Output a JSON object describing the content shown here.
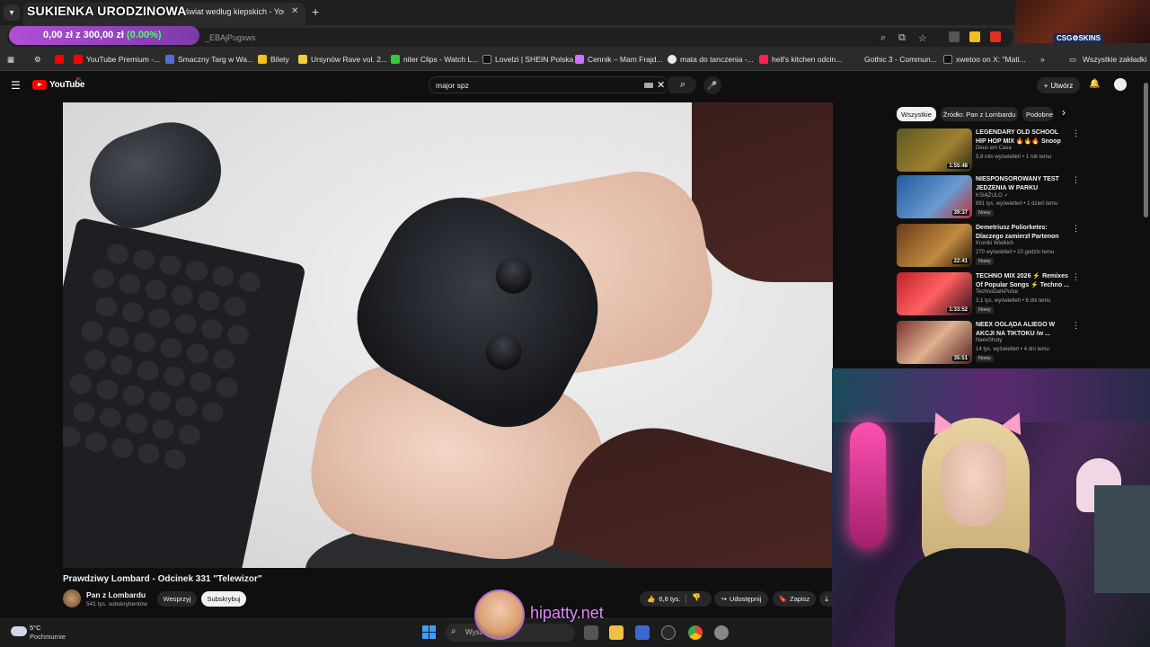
{
  "browser": {
    "overlay_title": "SUKIENKA URODZINOWA",
    "tab_title": "świat według kiepskich - YouTube",
    "tab_close": "✕",
    "new_tab": "+",
    "url_fragment": "_EBAjPugxws",
    "donation": {
      "amount": "0,00 zł",
      "sep": "z",
      "goal": "300,00 zł",
      "percent": "(0.00%)"
    },
    "bookmarks": [
      {
        "label": "YouTube Premium -...",
        "color": "#ff0000"
      },
      {
        "label": "Smaczny Targ w Wa...",
        "color": "#5b6bd6"
      },
      {
        "label": "Bilety",
        "color": "#f0c020"
      },
      {
        "label": "Ursynów Rave vol. 2...",
        "color": "#f0d040"
      },
      {
        "label": "niter Clips - Watch L...",
        "color": "#33cc33"
      },
      {
        "label": "Lovelzi | SHEIN Polska",
        "color": "#111111"
      },
      {
        "label": "Cennik – Mam Frajd...",
        "color": "#d070ff"
      },
      {
        "label": "mata do tanczenia -...",
        "color": "#e8e8e8"
      },
      {
        "label": "hell's kitchen odcin...",
        "color": "#ff2050"
      },
      {
        "label": "Gothic 3 - Commun...",
        "color": "#777777"
      },
      {
        "label": "xwetoo on X: \"Mati...",
        "color": "#111111"
      }
    ],
    "all_bookmarks": "Wszystkie zakładki",
    "csg_badge": "CSG⚙SKINS"
  },
  "youtube": {
    "logo_text": "YouTube",
    "logo_region": "PL",
    "search_value": "major spz",
    "create_label": "Utwórz",
    "video": {
      "title": "Prawdziwy Lombard - Odcinek 331 \"Telewizor\"",
      "channel": "Pan z Lombardu",
      "subscribers": "541 tys. subskrybentów",
      "support_label": "Wesprzyj",
      "subscribe_label": "Subskrybuj",
      "likes": "6,8 tys.",
      "share_label": "Udostępnij",
      "save_label": "Zapisz"
    },
    "chips": [
      "Wszystkie",
      "Źródło: Pan z Lombardu",
      "Podobne"
    ],
    "recommendations": [
      {
        "title": "LEGENDARY OLD SCHOOL HIP HOP MIX 🔥🔥🔥 Snoop Dogg...",
        "channel": "Deus em Casa",
        "meta": "5,8 mln wyświetleń • 1 rok temu",
        "duration": "1:55:48",
        "new": "",
        "thumb": "#3a3a10"
      },
      {
        "title": "NIESPONSOROWANY TEST JEDZENIA W PARKU ROZRYWKI",
        "channel": "KSIĄŻULO ✓",
        "meta": "691 tys. wyświetleń • 1 dzień temu",
        "duration": "39:37",
        "new": "Nowy",
        "thumb": "#1f5aa0"
      },
      {
        "title": "Demetriusz Poliorketes: Dlaczego zamierzł Partenon w...",
        "channel": "Kroniki Wielkich",
        "meta": "270 wyświetleń • 10 godzin temu",
        "duration": "22:41",
        "new": "Nowy",
        "thumb": "#6a3a18"
      },
      {
        "title": "TECHNO MIX 2026 ⚡ Remixes Of Popular Songs ⚡ Techno ...",
        "channel": "TechnoDarkPulse",
        "meta": "3,1 tys. wyświetleń • 6 dni temu",
        "duration": "1:33:52",
        "new": "Nowy",
        "thumb": "#c0202a"
      },
      {
        "title": "NEEX OGLĄDA ALIEGO W AKCJI NA TIKTOKU /w ...",
        "channel": "NeexShoty",
        "meta": "14 tys. wyświetleń • 4 dni temu",
        "duration": "35:51",
        "new": "Nowy",
        "thumb": "#7a3030"
      }
    ]
  },
  "taskbar": {
    "temp": "5°C",
    "weather": "Pochmurnie",
    "search_placeholder": "Wysz",
    "watermark": "hipatty.net"
  },
  "icons": {
    "menu": "☰",
    "search": "⌕",
    "mic": "🎤",
    "bell": "🔔",
    "more": "⋮",
    "close": "✕",
    "plus": "+",
    "chevron_right": "›",
    "like": "👍",
    "dislike": "👎",
    "share": "↪",
    "save": "🔖",
    "download": "⤓"
  }
}
